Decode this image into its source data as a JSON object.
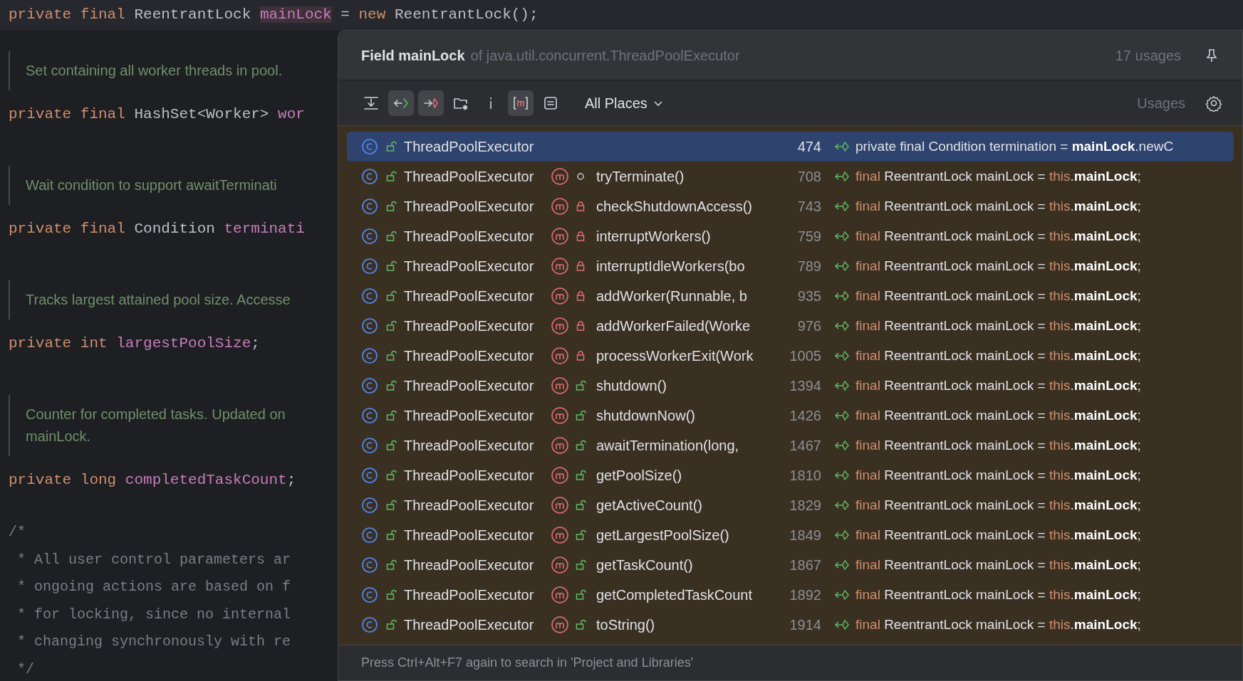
{
  "editor": {
    "current_line": [
      {
        "kind": "keyword",
        "text": "private final "
      },
      {
        "kind": "plain",
        "text": "ReentrantLock "
      },
      {
        "kind": "field_hl",
        "text": "mainLock"
      },
      {
        "kind": "plain",
        "text": " = "
      },
      {
        "kind": "keyword",
        "text": "new "
      },
      {
        "kind": "plain",
        "text": "ReentrantLock();"
      }
    ],
    "blocks": [
      {
        "kind": "doc",
        "lines": [
          "Set containing all worker threads in pool."
        ]
      },
      {
        "kind": "code",
        "segments": [
          {
            "kind": "keyword",
            "text": "private final "
          },
          {
            "kind": "plain",
            "text": "HashSet<Worker> "
          },
          {
            "kind": "field",
            "text": "wor"
          }
        ]
      },
      {
        "kind": "doc",
        "lines": [
          "Wait condition to support awaitTerminati"
        ]
      },
      {
        "kind": "code",
        "segments": [
          {
            "kind": "keyword",
            "text": "private final "
          },
          {
            "kind": "plain",
            "text": "Condition "
          },
          {
            "kind": "field",
            "text": "terminati"
          }
        ]
      },
      {
        "kind": "doc",
        "lines": [
          "Tracks largest attained pool size. Accesse"
        ]
      },
      {
        "kind": "code",
        "segments": [
          {
            "kind": "keyword",
            "text": "private int "
          },
          {
            "kind": "field",
            "text": "largestPoolSize"
          },
          {
            "kind": "plain",
            "text": ";"
          }
        ]
      },
      {
        "kind": "doc",
        "lines": [
          "Counter for completed tasks. Updated on",
          "mainLock."
        ]
      },
      {
        "kind": "code",
        "segments": [
          {
            "kind": "keyword",
            "text": "private long "
          },
          {
            "kind": "field",
            "text": "completedTaskCount"
          },
          {
            "kind": "plain",
            "text": ";"
          }
        ]
      },
      {
        "kind": "comment",
        "lines": [
          "/*",
          " * All user control parameters ar",
          " * ongoing actions are based on f",
          " * for locking, since no internal",
          " * changing synchronously with re",
          " */"
        ]
      }
    ]
  },
  "popup": {
    "title": "Field mainLock",
    "subtitle": "of java.util.concurrent.ThreadPoolExecutor",
    "usage_count": "17 usages",
    "toolbar": [
      {
        "kind": "expand",
        "selected": false
      },
      {
        "kind": "read",
        "selected": true
      },
      {
        "kind": "write",
        "selected": true
      },
      {
        "kind": "folder",
        "selected": false
      },
      {
        "kind": "info",
        "selected": false
      },
      {
        "kind": "method",
        "selected": true
      },
      {
        "kind": "preview",
        "selected": false
      }
    ],
    "scope": "All Places",
    "grouping": "Usages",
    "rows": [
      {
        "class": "ThreadPoolExecutor",
        "line": "474",
        "selected": true,
        "code": [
          {
            "kind": "plain",
            "text": "private final Condition termination = "
          },
          {
            "kind": "bold",
            "text": "mainLock"
          },
          {
            "kind": "plain",
            "text": ".newC"
          }
        ]
      },
      {
        "class": "ThreadPoolExecutor",
        "method": "tryTerminate()",
        "kind": "package",
        "line": "708",
        "selected": false,
        "code": [
          {
            "kind": "keyword",
            "text": "final"
          },
          {
            "kind": "plain",
            "text": " ReentrantLock mainLock = "
          },
          {
            "kind": "keyword",
            "text": "this"
          },
          {
            "kind": "plain",
            "text": "."
          },
          {
            "kind": "bold",
            "text": "mainLock"
          },
          {
            "kind": "plain",
            "text": ";"
          }
        ]
      },
      {
        "class": "ThreadPoolExecutor",
        "method": "checkShutdownAccess()",
        "kind": "private",
        "line": "743",
        "selected": false,
        "code": [
          {
            "kind": "keyword",
            "text": "final"
          },
          {
            "kind": "plain",
            "text": " ReentrantLock mainLock = "
          },
          {
            "kind": "keyword",
            "text": "this"
          },
          {
            "kind": "plain",
            "text": "."
          },
          {
            "kind": "bold",
            "text": "mainLock"
          },
          {
            "kind": "plain",
            "text": ";"
          }
        ]
      },
      {
        "class": "ThreadPoolExecutor",
        "method": "interruptWorkers()",
        "kind": "private",
        "line": "759",
        "selected": false,
        "code": [
          {
            "kind": "keyword",
            "text": "final"
          },
          {
            "kind": "plain",
            "text": " ReentrantLock mainLock = "
          },
          {
            "kind": "keyword",
            "text": "this"
          },
          {
            "kind": "plain",
            "text": "."
          },
          {
            "kind": "bold",
            "text": "mainLock"
          },
          {
            "kind": "plain",
            "text": ";"
          }
        ]
      },
      {
        "class": "ThreadPoolExecutor",
        "method": "interruptIdleWorkers(bo",
        "kind": "private",
        "line": "789",
        "selected": false,
        "code": [
          {
            "kind": "keyword",
            "text": "final"
          },
          {
            "kind": "plain",
            "text": " ReentrantLock mainLock = "
          },
          {
            "kind": "keyword",
            "text": "this"
          },
          {
            "kind": "plain",
            "text": "."
          },
          {
            "kind": "bold",
            "text": "mainLock"
          },
          {
            "kind": "plain",
            "text": ";"
          }
        ]
      },
      {
        "class": "ThreadPoolExecutor",
        "method": "addWorker(Runnable, b",
        "kind": "private",
        "line": "935",
        "selected": false,
        "code": [
          {
            "kind": "keyword",
            "text": "final"
          },
          {
            "kind": "plain",
            "text": " ReentrantLock mainLock = "
          },
          {
            "kind": "keyword",
            "text": "this"
          },
          {
            "kind": "plain",
            "text": "."
          },
          {
            "kind": "bold",
            "text": "mainLock"
          },
          {
            "kind": "plain",
            "text": ";"
          }
        ]
      },
      {
        "class": "ThreadPoolExecutor",
        "method": "addWorkerFailed(Worke",
        "kind": "private",
        "line": "976",
        "selected": false,
        "code": [
          {
            "kind": "keyword",
            "text": "final"
          },
          {
            "kind": "plain",
            "text": " ReentrantLock mainLock = "
          },
          {
            "kind": "keyword",
            "text": "this"
          },
          {
            "kind": "plain",
            "text": "."
          },
          {
            "kind": "bold",
            "text": "mainLock"
          },
          {
            "kind": "plain",
            "text": ";"
          }
        ]
      },
      {
        "class": "ThreadPoolExecutor",
        "method": "processWorkerExit(Work",
        "kind": "private",
        "line": "1005",
        "selected": false,
        "code": [
          {
            "kind": "keyword",
            "text": "final"
          },
          {
            "kind": "plain",
            "text": " ReentrantLock mainLock = "
          },
          {
            "kind": "keyword",
            "text": "this"
          },
          {
            "kind": "plain",
            "text": "."
          },
          {
            "kind": "bold",
            "text": "mainLock"
          },
          {
            "kind": "plain",
            "text": ";"
          }
        ]
      },
      {
        "class": "ThreadPoolExecutor",
        "method": "shutdown()",
        "kind": "public",
        "line": "1394",
        "selected": false,
        "code": [
          {
            "kind": "keyword",
            "text": "final"
          },
          {
            "kind": "plain",
            "text": " ReentrantLock mainLock = "
          },
          {
            "kind": "keyword",
            "text": "this"
          },
          {
            "kind": "plain",
            "text": "."
          },
          {
            "kind": "bold",
            "text": "mainLock"
          },
          {
            "kind": "plain",
            "text": ";"
          }
        ]
      },
      {
        "class": "ThreadPoolExecutor",
        "method": "shutdownNow()",
        "kind": "public",
        "line": "1426",
        "selected": false,
        "code": [
          {
            "kind": "keyword",
            "text": "final"
          },
          {
            "kind": "plain",
            "text": " ReentrantLock mainLock = "
          },
          {
            "kind": "keyword",
            "text": "this"
          },
          {
            "kind": "plain",
            "text": "."
          },
          {
            "kind": "bold",
            "text": "mainLock"
          },
          {
            "kind": "plain",
            "text": ";"
          }
        ]
      },
      {
        "class": "ThreadPoolExecutor",
        "method": "awaitTermination(long,",
        "kind": "public",
        "line": "1467",
        "selected": false,
        "code": [
          {
            "kind": "keyword",
            "text": "final"
          },
          {
            "kind": "plain",
            "text": " ReentrantLock mainLock = "
          },
          {
            "kind": "keyword",
            "text": "this"
          },
          {
            "kind": "plain",
            "text": "."
          },
          {
            "kind": "bold",
            "text": "mainLock"
          },
          {
            "kind": "plain",
            "text": ";"
          }
        ]
      },
      {
        "class": "ThreadPoolExecutor",
        "method": "getPoolSize()",
        "kind": "public",
        "line": "1810",
        "selected": false,
        "code": [
          {
            "kind": "keyword",
            "text": "final"
          },
          {
            "kind": "plain",
            "text": " ReentrantLock mainLock = "
          },
          {
            "kind": "keyword",
            "text": "this"
          },
          {
            "kind": "plain",
            "text": "."
          },
          {
            "kind": "bold",
            "text": "mainLock"
          },
          {
            "kind": "plain",
            "text": ";"
          }
        ]
      },
      {
        "class": "ThreadPoolExecutor",
        "method": "getActiveCount()",
        "kind": "public",
        "line": "1829",
        "selected": false,
        "code": [
          {
            "kind": "keyword",
            "text": "final"
          },
          {
            "kind": "plain",
            "text": " ReentrantLock mainLock = "
          },
          {
            "kind": "keyword",
            "text": "this"
          },
          {
            "kind": "plain",
            "text": "."
          },
          {
            "kind": "bold",
            "text": "mainLock"
          },
          {
            "kind": "plain",
            "text": ";"
          }
        ]
      },
      {
        "class": "ThreadPoolExecutor",
        "method": "getLargestPoolSize()",
        "kind": "public",
        "line": "1849",
        "selected": false,
        "code": [
          {
            "kind": "keyword",
            "text": "final"
          },
          {
            "kind": "plain",
            "text": " ReentrantLock mainLock = "
          },
          {
            "kind": "keyword",
            "text": "this"
          },
          {
            "kind": "plain",
            "text": "."
          },
          {
            "kind": "bold",
            "text": "mainLock"
          },
          {
            "kind": "plain",
            "text": ";"
          }
        ]
      },
      {
        "class": "ThreadPoolExecutor",
        "method": "getTaskCount()",
        "kind": "public",
        "line": "1867",
        "selected": false,
        "code": [
          {
            "kind": "keyword",
            "text": "final"
          },
          {
            "kind": "plain",
            "text": " ReentrantLock mainLock = "
          },
          {
            "kind": "keyword",
            "text": "this"
          },
          {
            "kind": "plain",
            "text": "."
          },
          {
            "kind": "bold",
            "text": "mainLock"
          },
          {
            "kind": "plain",
            "text": ";"
          }
        ]
      },
      {
        "class": "ThreadPoolExecutor",
        "method": "getCompletedTaskCount",
        "kind": "public",
        "line": "1892",
        "selected": false,
        "code": [
          {
            "kind": "keyword",
            "text": "final"
          },
          {
            "kind": "plain",
            "text": " ReentrantLock mainLock = "
          },
          {
            "kind": "keyword",
            "text": "this"
          },
          {
            "kind": "plain",
            "text": "."
          },
          {
            "kind": "bold",
            "text": "mainLock"
          },
          {
            "kind": "plain",
            "text": ";"
          }
        ]
      },
      {
        "class": "ThreadPoolExecutor",
        "method": "toString()",
        "kind": "public",
        "line": "1914",
        "selected": false,
        "code": [
          {
            "kind": "keyword",
            "text": "final"
          },
          {
            "kind": "plain",
            "text": " ReentrantLock mainLock = "
          },
          {
            "kind": "keyword",
            "text": "this"
          },
          {
            "kind": "plain",
            "text": "."
          },
          {
            "kind": "bold",
            "text": "mainLock"
          },
          {
            "kind": "plain",
            "text": ";"
          }
        ]
      }
    ],
    "footer": "Press Ctrl+Alt+F7 again to search in 'Project and Libraries'"
  }
}
